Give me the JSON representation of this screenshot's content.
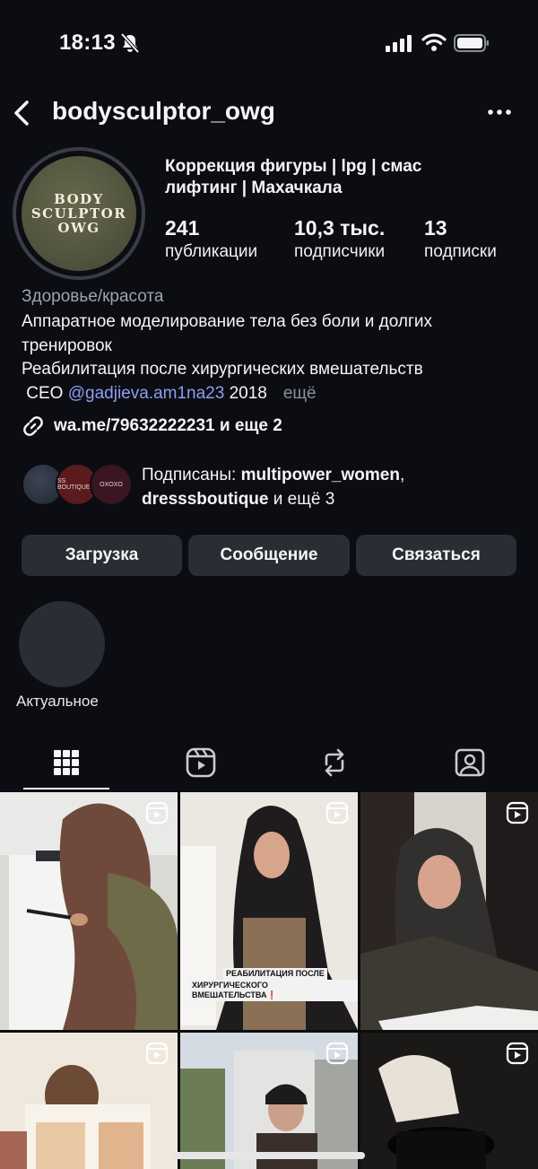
{
  "status_bar": {
    "time": "18:13"
  },
  "header": {
    "username": "bodysculptor_owg"
  },
  "profile": {
    "avatar_text": [
      "BODY",
      "SCULPTOR",
      "OWG"
    ],
    "full_name": "Коррекция фигуры | lpg | смас лифтинг | Махачкала",
    "stats": [
      {
        "value": "241",
        "label": "публикации"
      },
      {
        "value": "10,3 тыс.",
        "label": "подписчики"
      },
      {
        "value": "13",
        "label": "подписки"
      }
    ],
    "category": "Здоровье/красота",
    "bio_lines": [
      "Аппаратное моделирование тела без боли и долгих",
      "тренировок",
      "Реабилитация после хирургических вмешательств"
    ],
    "bio_last_prefix": " CEO ",
    "bio_mention": "@gadjieva.am1na23",
    "bio_last_suffix": " 2018",
    "bio_more": "ещё",
    "link": "wa.me/79632222231 и еще 2"
  },
  "followed_by": {
    "prefix": "Подписаны: ",
    "user1": "multipower_women",
    "sep": ",",
    "user2": "dresssboutique",
    "suffix": " и ещё 3",
    "avatar_texts": [
      "",
      "SS BOUTIQUE",
      "OXOXO"
    ]
  },
  "actions": {
    "upload": "Загрузка",
    "message": "Сообщение",
    "contact": "Связаться"
  },
  "highlights": {
    "label": "Актуальное"
  },
  "grid": {
    "captions": {
      "tile2_line1": "РЕАБИЛИТАЦИЯ ПОСЛЕ",
      "tile2_line2": "ХИРУРГИЧЕСКОГО ВМЕШАТЕЛЬСТВА❗"
    }
  },
  "colors": {
    "background": "#0b0d12",
    "button": "#2a2d34",
    "mention": "#8f9df2",
    "muted": "#9fa3ab"
  }
}
